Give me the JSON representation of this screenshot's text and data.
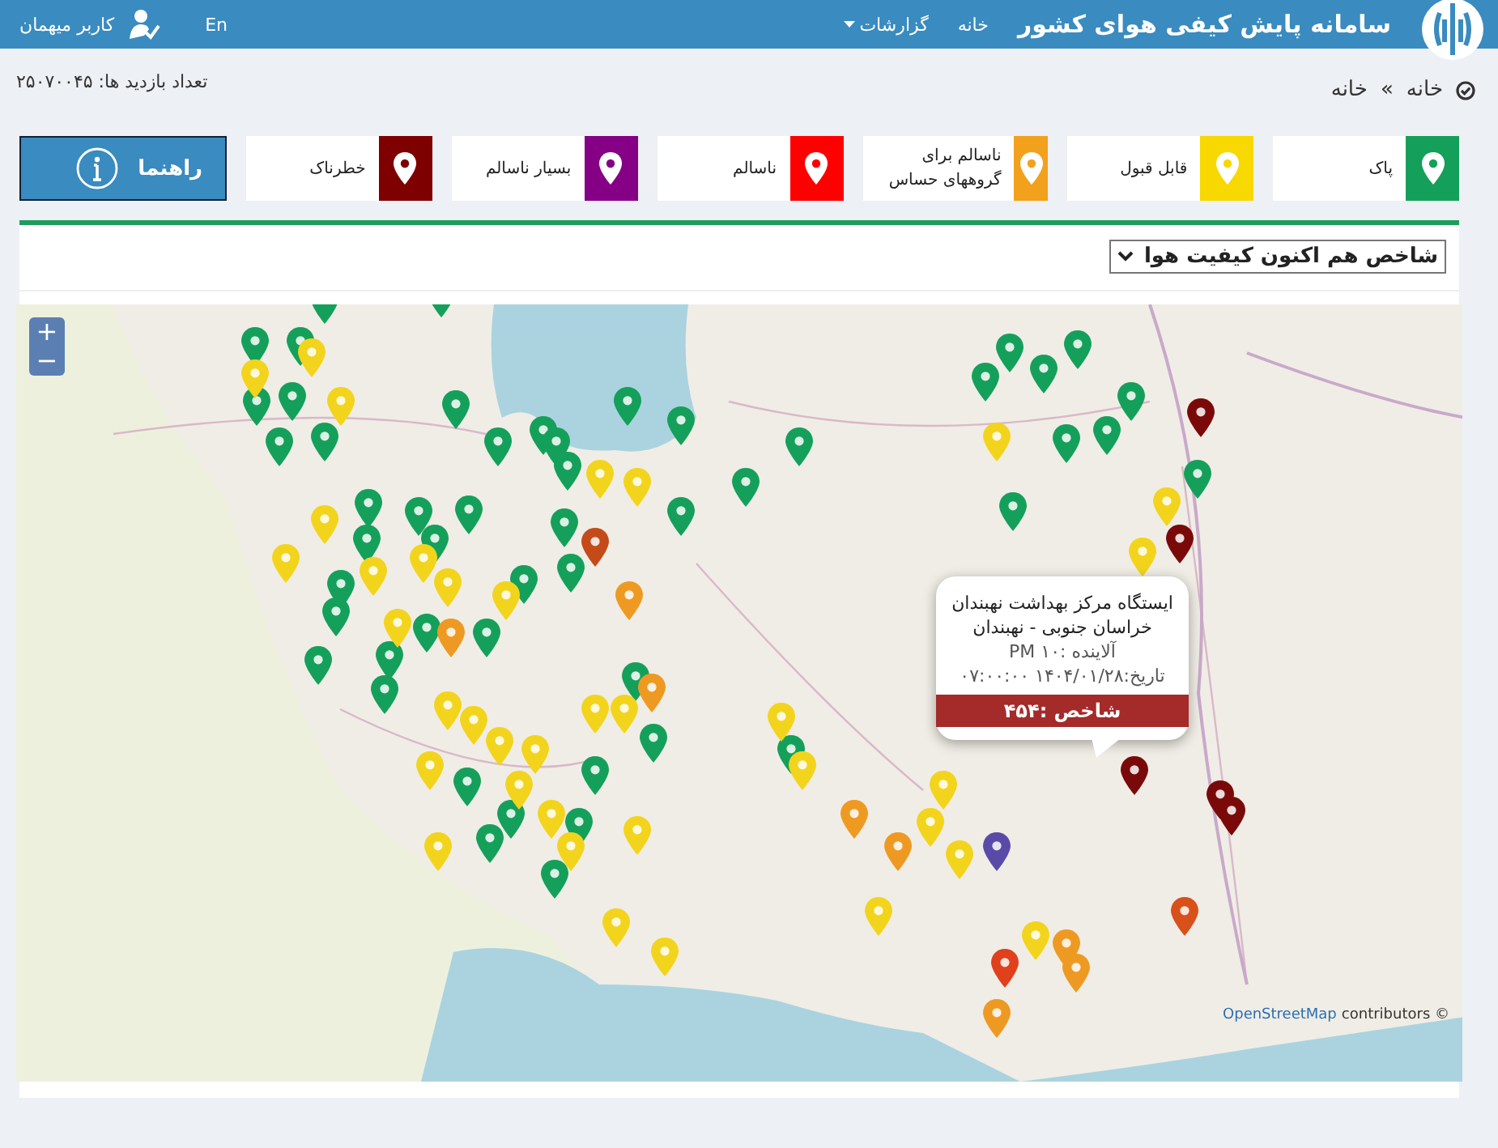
{
  "header": {
    "title": "سامانه پایش کیفی هوای کشور",
    "nav": [
      {
        "label": "خانه",
        "kind": "link"
      },
      {
        "label": "گزارشات",
        "kind": "dropdown"
      }
    ],
    "user": "کاربر میهمان",
    "language": "En"
  },
  "breadcrumb": [
    "خانه",
    "»",
    "خانه"
  ],
  "visits": "تعداد بازدید ها: ۲۵۰۷۰۰۴۵",
  "legend": [
    {
      "label": "پاک",
      "color": "#14a05a"
    },
    {
      "label": "قابل قبول",
      "color": "#f7d800"
    },
    {
      "label": "ناسالم برای گروههای حساس",
      "color": "#f2a11d"
    },
    {
      "label": "ناسالم",
      "color": "#ff0000"
    },
    {
      "label": "بسیار ناسالم",
      "color": "#850085"
    },
    {
      "label": "خطرناک",
      "color": "#7e0000"
    }
  ],
  "guide_button": "راهنما",
  "index_select": {
    "value": "شاخص هم اکنون کیفیت هوا"
  },
  "map": {
    "zoom": [
      "+",
      "−"
    ],
    "attribution_link": "OpenStreetMap",
    "attribution": "contributors ©",
    "popup": {
      "station": "ایستگاه مرکز بهداشت نهبندان",
      "location": "خراسان جنوبی - نهبندان",
      "pollutant": "آلاینده :۱۰ PM",
      "date": "تاریخ:۱۴۰۴/۰۱/۲۸ ۰۷:۰۰:۰۰",
      "index": "شاخص :۴۵۴",
      "color": "#a52a2a"
    },
    "markers": [
      {
        "color": "#14a05a"
      },
      {
        "color": "#14a05a"
      },
      {
        "color": "#14a05a"
      },
      {
        "color": "#14a05a"
      },
      {
        "color": "#14a05a"
      },
      {
        "color": "#14a05a"
      },
      {
        "color": "#14a05a"
      },
      {
        "color": "#14a05a"
      },
      {
        "color": "#14a05a"
      },
      {
        "color": "#14a05a"
      },
      {
        "color": "#14a05a"
      },
      {
        "color": "#14a05a"
      },
      {
        "color": "#14a05a"
      },
      {
        "color": "#14a05a"
      },
      {
        "color": "#14a05a"
      },
      {
        "color": "#14a05a"
      },
      {
        "color": "#14a05a"
      },
      {
        "color": "#14a05a"
      },
      {
        "color": "#14a05a"
      },
      {
        "color": "#14a05a"
      },
      {
        "color": "#14a05a"
      },
      {
        "color": "#14a05a"
      },
      {
        "color": "#14a05a"
      },
      {
        "color": "#14a05a"
      },
      {
        "color": "#14a05a"
      },
      {
        "color": "#14a05a"
      },
      {
        "color": "#14a05a"
      },
      {
        "color": "#14a05a"
      },
      {
        "color": "#14a05a"
      },
      {
        "color": "#14a05a"
      },
      {
        "color": "#14a05a"
      },
      {
        "color": "#14a05a"
      },
      {
        "color": "#14a05a"
      },
      {
        "color": "#14a05a"
      },
      {
        "color": "#14a05a"
      },
      {
        "color": "#14a05a"
      },
      {
        "color": "#14a05a"
      },
      {
        "color": "#14a05a"
      },
      {
        "color": "#14a05a"
      },
      {
        "color": "#14a05a"
      },
      {
        "color": "#14a05a"
      },
      {
        "color": "#14a05a"
      },
      {
        "color": "#14a05a"
      },
      {
        "color": "#14a05a"
      },
      {
        "color": "#14a05a"
      },
      {
        "color": "#14a05a"
      },
      {
        "color": "#14a05a"
      },
      {
        "color": "#14a05a"
      },
      {
        "color": "#14a05a"
      },
      {
        "color": "#14a05a"
      },
      {
        "color": "#14a05a"
      },
      {
        "color": "#f3d41c"
      },
      {
        "color": "#f3d41c"
      },
      {
        "color": "#f3d41c"
      },
      {
        "color": "#f3d41c"
      },
      {
        "color": "#f3d41c"
      },
      {
        "color": "#f3d41c"
      },
      {
        "color": "#f3d41c"
      },
      {
        "color": "#f3d41c"
      },
      {
        "color": "#f3d41c"
      },
      {
        "color": "#f3d41c"
      },
      {
        "color": "#f3d41c"
      },
      {
        "color": "#f3d41c"
      },
      {
        "color": "#f3d41c"
      },
      {
        "color": "#f3d41c"
      },
      {
        "color": "#f3d41c"
      },
      {
        "color": "#f3d41c"
      },
      {
        "color": "#f3d41c"
      },
      {
        "color": "#f3d41c"
      },
      {
        "color": "#f3d41c"
      },
      {
        "color": "#f3d41c"
      },
      {
        "color": "#f3d41c"
      },
      {
        "color": "#f3d41c"
      },
      {
        "color": "#f3d41c"
      },
      {
        "color": "#f3d41c"
      },
      {
        "color": "#f3d41c"
      },
      {
        "color": "#f3d41c"
      },
      {
        "color": "#f3d41c"
      },
      {
        "color": "#f3d41c"
      },
      {
        "color": "#f3d41c"
      },
      {
        "color": "#f3d41c"
      },
      {
        "color": "#f3d41c"
      },
      {
        "color": "#f3d41c"
      },
      {
        "color": "#f3d41c"
      },
      {
        "color": "#f3d41c"
      },
      {
        "color": "#f3d41c"
      },
      {
        "color": "#f3d41c"
      },
      {
        "color": "#ee9a22"
      },
      {
        "color": "#ee9a22"
      },
      {
        "color": "#ee9a22"
      },
      {
        "color": "#ee9a22"
      },
      {
        "color": "#ee9a22"
      },
      {
        "color": "#ee9a22"
      },
      {
        "color": "#ee9a22"
      },
      {
        "color": "#ee9a22"
      },
      {
        "color": "#c44a1a"
      },
      {
        "color": "#e0401c"
      },
      {
        "color": "#d8501a"
      },
      {
        "color": "#5a4aa8"
      },
      {
        "color": "#7a0a0a"
      },
      {
        "color": "#7a0a0a"
      },
      {
        "color": "#7a0a0a"
      },
      {
        "color": "#7a0a0a"
      },
      {
        "color": "#7a0a0a"
      }
    ]
  }
}
